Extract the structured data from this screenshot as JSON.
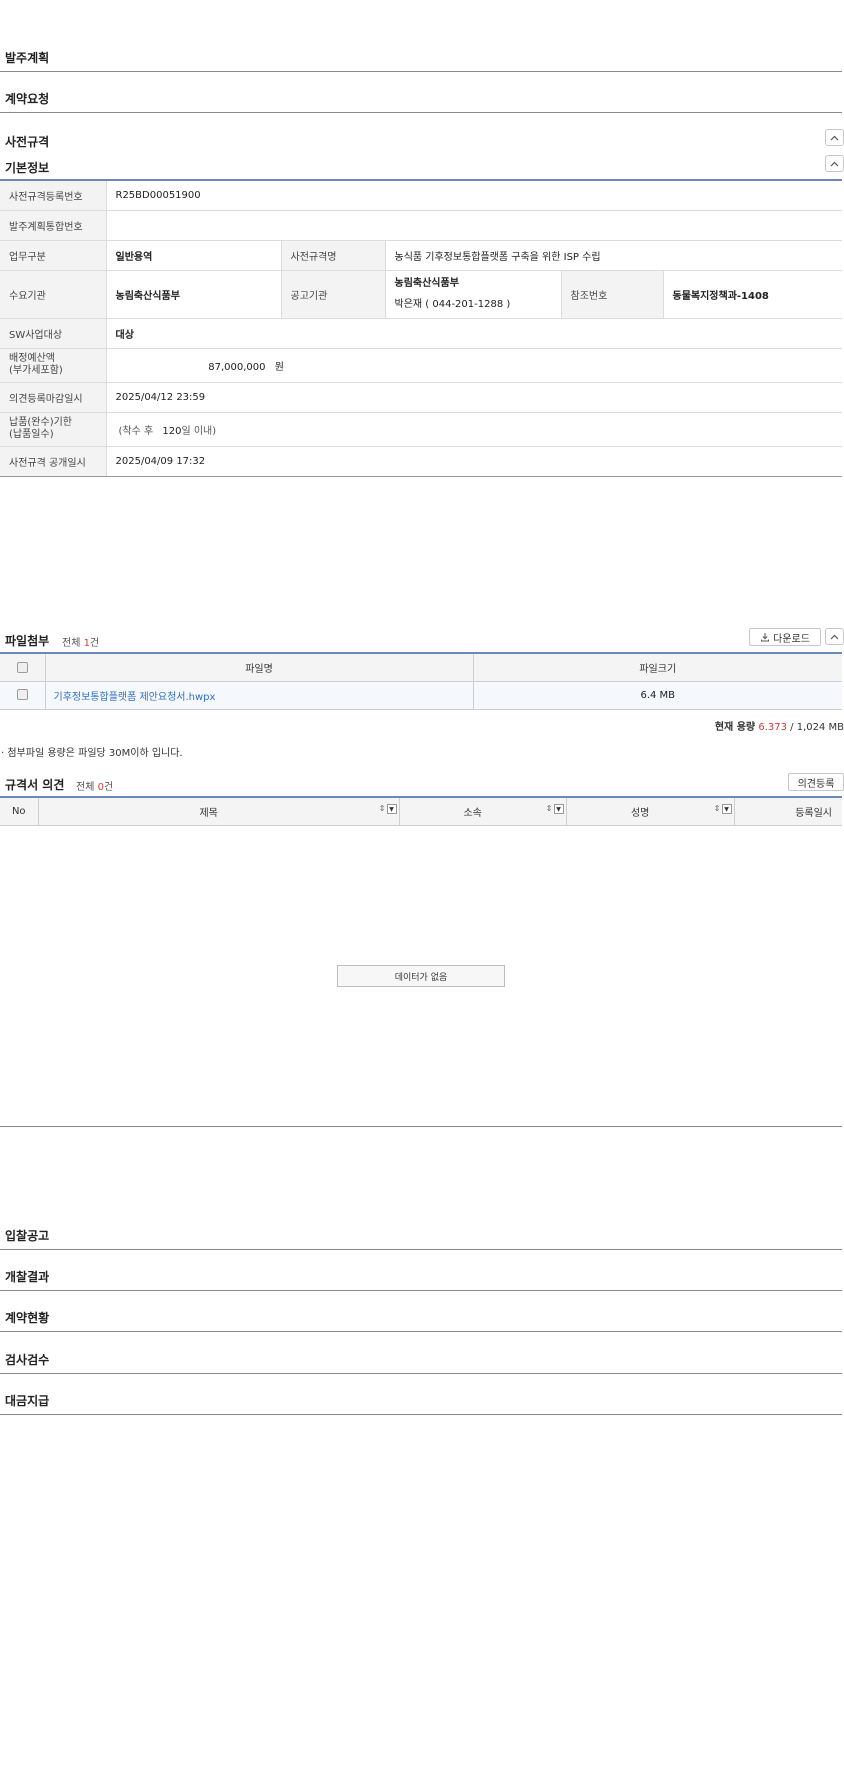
{
  "sections_top": [
    {
      "title": "발주계획"
    },
    {
      "title": "계약요청"
    },
    {
      "title": "사전규격"
    }
  ],
  "basic_info": {
    "title": "기본정보",
    "reg_no_label": "사전규격등록번호",
    "reg_no": "R25BD00051900",
    "plan_no_label": "발주계획통합번호",
    "plan_no": "",
    "biz_type_label": "업무구분",
    "biz_type": "일반용역",
    "spec_name_label": "사전규격명",
    "spec_name": "농식품 기후정보통합플랫폼 구축을 위한 ISP 수립",
    "demand_org_label": "수요기관",
    "demand_org": "농림축산식품부",
    "notice_org_label": "공고기관",
    "notice_org": "농림축산식품부",
    "notice_contact": "박은재 ( 044-201-1288 )",
    "ref_no_label": "참조번호",
    "ref_no": "동물복지정책과-1408",
    "sw_label": "SW사업대상",
    "sw_value": "대상",
    "budget_label_1": "배정예산액",
    "budget_label_2": "(부가세포함)",
    "budget_amount": "87,000,000",
    "budget_unit": "원",
    "comment_deadline_label": "의견등록마감일시",
    "comment_deadline": "2025/04/12 23:59",
    "delivery_label_1": "납품(완수)기한",
    "delivery_label_2": "(납품일수)",
    "delivery_prefix": "(착수 후",
    "delivery_days": "120",
    "delivery_suffix": "일 이내)",
    "open_date_label": "사전규격 공개일시",
    "open_date": "2025/04/09 17:32"
  },
  "attachments": {
    "title": "파일첨부",
    "count_prefix": "전체 ",
    "count": "1",
    "count_suffix": "건",
    "download_label": "다운로드",
    "col_name": "파일명",
    "col_size": "파일크기",
    "files": [
      {
        "name": "기후정보통합플랫폼 제안요청서.hwpx",
        "size": "6.4 MB"
      }
    ],
    "usage_label": "현재 용량",
    "usage_current": "6.373",
    "usage_total": "/ 1,024 MB",
    "note": "· 첨부파일 용량은 파일당 30M이하 입니다."
  },
  "opinions": {
    "title": "규격서 의견",
    "count_prefix": "전체 ",
    "count": "0",
    "count_suffix": "건",
    "register_label": "의견등록",
    "columns": [
      "No",
      "제목",
      "소속",
      "성명",
      "등록일시"
    ],
    "empty_message": "데이터가 없음"
  },
  "sections_bottom": [
    {
      "title": "입찰공고"
    },
    {
      "title": "개찰결과"
    },
    {
      "title": "계약현황"
    },
    {
      "title": "검사검수"
    },
    {
      "title": "대금지급"
    }
  ]
}
